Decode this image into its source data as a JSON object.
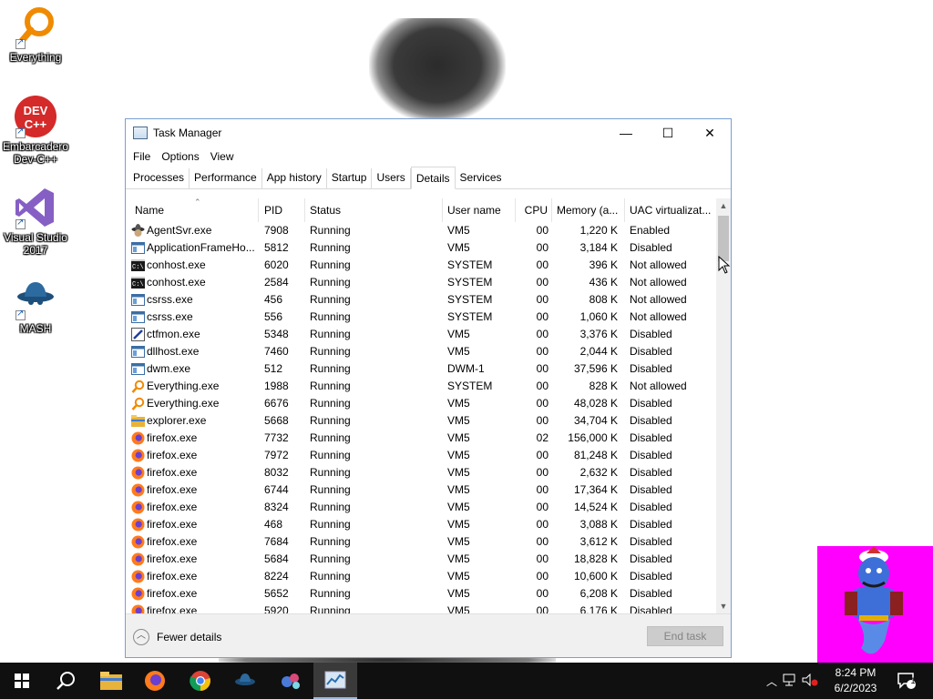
{
  "desktop": {
    "icons": [
      {
        "label": "Everything",
        "icon": "everything-icon"
      },
      {
        "label": "Embarcadero Dev-C++",
        "icon": "devcpp-icon"
      },
      {
        "label": "Visual Studio 2017",
        "icon": "visual-studio-icon"
      },
      {
        "label": "MASH",
        "icon": "mash-icon"
      }
    ]
  },
  "window": {
    "title": "Task Manager",
    "minimize": "—",
    "maximize": "☐",
    "close": "✕"
  },
  "menu": [
    "File",
    "Options",
    "View"
  ],
  "tabs": [
    "Processes",
    "Performance",
    "App history",
    "Startup",
    "Users",
    "Details",
    "Services"
  ],
  "active_tab": "Details",
  "columns": [
    "Name",
    "PID",
    "Status",
    "User name",
    "CPU",
    "Memory (a...",
    "UAC virtualizat..."
  ],
  "processes": [
    {
      "name": "AgentSvr.exe",
      "pid": "7908",
      "status": "Running",
      "user": "VM5",
      "cpu": "00",
      "mem": "1,220 K",
      "uac": "Enabled",
      "icon": "agent-icon"
    },
    {
      "name": "ApplicationFrameHo...",
      "pid": "5812",
      "status": "Running",
      "user": "VM5",
      "cpu": "00",
      "mem": "3,184 K",
      "uac": "Disabled",
      "icon": "window-app-icon"
    },
    {
      "name": "conhost.exe",
      "pid": "6020",
      "status": "Running",
      "user": "SYSTEM",
      "cpu": "00",
      "mem": "396 K",
      "uac": "Not allowed",
      "icon": "console-icon"
    },
    {
      "name": "conhost.exe",
      "pid": "2584",
      "status": "Running",
      "user": "SYSTEM",
      "cpu": "00",
      "mem": "436 K",
      "uac": "Not allowed",
      "icon": "console-icon"
    },
    {
      "name": "csrss.exe",
      "pid": "456",
      "status": "Running",
      "user": "SYSTEM",
      "cpu": "00",
      "mem": "808 K",
      "uac": "Not allowed",
      "icon": "window-app-icon"
    },
    {
      "name": "csrss.exe",
      "pid": "556",
      "status": "Running",
      "user": "SYSTEM",
      "cpu": "00",
      "mem": "1,060 K",
      "uac": "Not allowed",
      "icon": "window-app-icon"
    },
    {
      "name": "ctfmon.exe",
      "pid": "5348",
      "status": "Running",
      "user": "VM5",
      "cpu": "00",
      "mem": "3,376 K",
      "uac": "Disabled",
      "icon": "pen-icon"
    },
    {
      "name": "dllhost.exe",
      "pid": "7460",
      "status": "Running",
      "user": "VM5",
      "cpu": "00",
      "mem": "2,044 K",
      "uac": "Disabled",
      "icon": "window-app-icon"
    },
    {
      "name": "dwm.exe",
      "pid": "512",
      "status": "Running",
      "user": "DWM-1",
      "cpu": "00",
      "mem": "37,596 K",
      "uac": "Disabled",
      "icon": "window-app-icon"
    },
    {
      "name": "Everything.exe",
      "pid": "1988",
      "status": "Running",
      "user": "SYSTEM",
      "cpu": "00",
      "mem": "828 K",
      "uac": "Not allowed",
      "icon": "everything-icon"
    },
    {
      "name": "Everything.exe",
      "pid": "6676",
      "status": "Running",
      "user": "VM5",
      "cpu": "00",
      "mem": "48,028 K",
      "uac": "Disabled",
      "icon": "everything-icon"
    },
    {
      "name": "explorer.exe",
      "pid": "5668",
      "status": "Running",
      "user": "VM5",
      "cpu": "00",
      "mem": "34,704 K",
      "uac": "Disabled",
      "icon": "folder-icon"
    },
    {
      "name": "firefox.exe",
      "pid": "7732",
      "status": "Running",
      "user": "VM5",
      "cpu": "02",
      "mem": "156,000 K",
      "uac": "Disabled",
      "icon": "firefox-icon"
    },
    {
      "name": "firefox.exe",
      "pid": "7972",
      "status": "Running",
      "user": "VM5",
      "cpu": "00",
      "mem": "81,248 K",
      "uac": "Disabled",
      "icon": "firefox-icon"
    },
    {
      "name": "firefox.exe",
      "pid": "8032",
      "status": "Running",
      "user": "VM5",
      "cpu": "00",
      "mem": "2,632 K",
      "uac": "Disabled",
      "icon": "firefox-icon"
    },
    {
      "name": "firefox.exe",
      "pid": "6744",
      "status": "Running",
      "user": "VM5",
      "cpu": "00",
      "mem": "17,364 K",
      "uac": "Disabled",
      "icon": "firefox-icon"
    },
    {
      "name": "firefox.exe",
      "pid": "8324",
      "status": "Running",
      "user": "VM5",
      "cpu": "00",
      "mem": "14,524 K",
      "uac": "Disabled",
      "icon": "firefox-icon"
    },
    {
      "name": "firefox.exe",
      "pid": "468",
      "status": "Running",
      "user": "VM5",
      "cpu": "00",
      "mem": "3,088 K",
      "uac": "Disabled",
      "icon": "firefox-icon"
    },
    {
      "name": "firefox.exe",
      "pid": "7684",
      "status": "Running",
      "user": "VM5",
      "cpu": "00",
      "mem": "3,612 K",
      "uac": "Disabled",
      "icon": "firefox-icon"
    },
    {
      "name": "firefox.exe",
      "pid": "5684",
      "status": "Running",
      "user": "VM5",
      "cpu": "00",
      "mem": "18,828 K",
      "uac": "Disabled",
      "icon": "firefox-icon"
    },
    {
      "name": "firefox.exe",
      "pid": "8224",
      "status": "Running",
      "user": "VM5",
      "cpu": "00",
      "mem": "10,600 K",
      "uac": "Disabled",
      "icon": "firefox-icon"
    },
    {
      "name": "firefox.exe",
      "pid": "5652",
      "status": "Running",
      "user": "VM5",
      "cpu": "00",
      "mem": "6,208 K",
      "uac": "Disabled",
      "icon": "firefox-icon"
    },
    {
      "name": "firefox.exe",
      "pid": "5920",
      "status": "Running",
      "user": "VM5",
      "cpu": "00",
      "mem": "6,176 K",
      "uac": "Disabled",
      "icon": "firefox-icon"
    }
  ],
  "footer": {
    "fewer_details": "Fewer details",
    "end_task": "End task"
  },
  "taskbar": {
    "apps": [
      "start-icon",
      "search-icon",
      "file-explorer-icon",
      "firefox-icon",
      "chrome-icon",
      "mash-icon",
      "devcpp-icon",
      "task-manager-icon"
    ],
    "clock_time": "8:24 PM",
    "clock_date": "6/2/2023",
    "notification_count": "1"
  },
  "colors": {
    "taskbar": "#101010",
    "window_border": "#7a9fd3",
    "genie_background": "#ff00ff"
  }
}
